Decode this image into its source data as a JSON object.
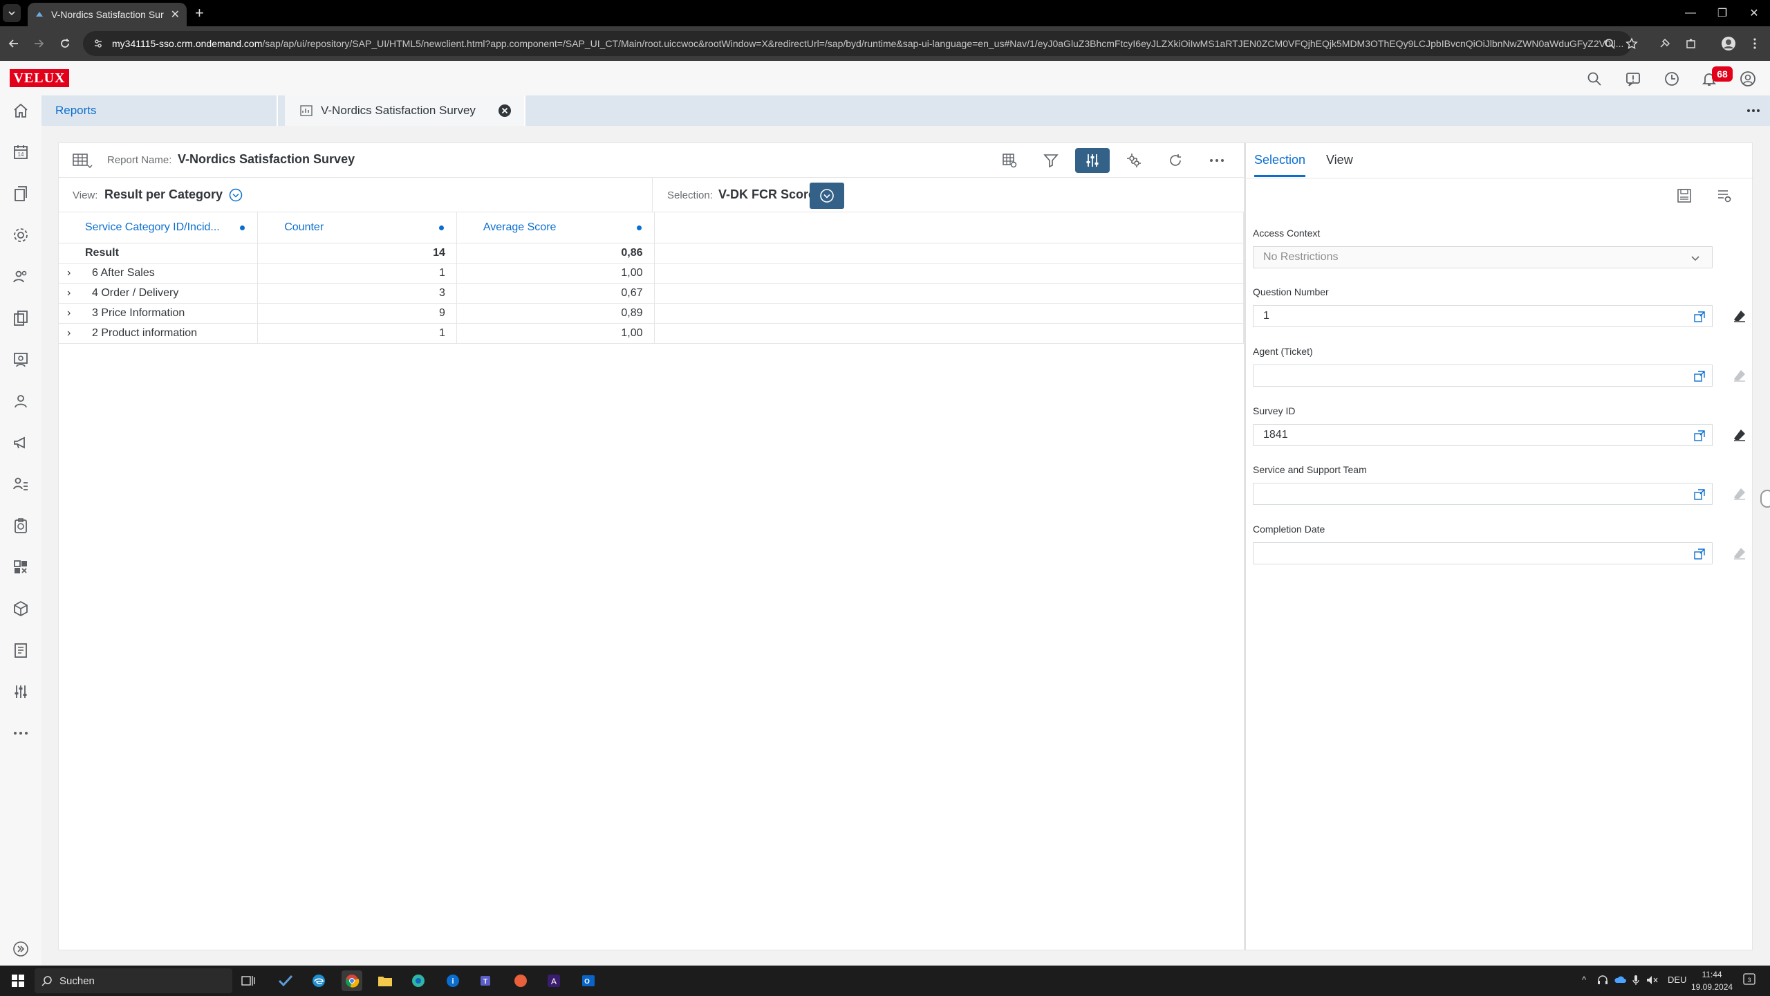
{
  "browser": {
    "tab_title": "V-Nordics Satisfaction Survey -",
    "url_host": "my341115-sso.crm.ondemand.com",
    "url_path": "/sap/ap/ui/repository/SAP_UI/HTML5/newclient.html?app.component=/SAP_UI_CT/Main/root.uiccwoc&rootWindow=X&redirectUrl=/sap/byd/runtime&sap-ui-language=en_us#Nav/1/eyJ0aGluZ3BhcmFtcyI6eyJLZXkiOiIwMS1aRTJEN0ZCM0VFQjhEQjk5MDM3OThEQy9LCJpbIBvcnQiOiJlbnNwZWN0aWduGFyZ2V0Il..."
  },
  "shell": {
    "logo": "VELUX",
    "notification_count": "68"
  },
  "tabs": {
    "reports": "Reports",
    "survey": "V-Nordics Satisfaction Survey"
  },
  "report": {
    "name_label": "Report Name:",
    "name": "V-Nordics Satisfaction Survey",
    "view_label": "View:",
    "view": "Result per Category",
    "selection_label": "Selection:",
    "selection": "V-DK FCR Score",
    "columns": [
      "Service Category ID/Incid...",
      "Counter",
      "Average Score"
    ],
    "result_row": {
      "label": "Result",
      "counter": "14",
      "avg": "0,86"
    },
    "rows": [
      {
        "label": "6 After Sales",
        "counter": "1",
        "avg": "1,00"
      },
      {
        "label": "4 Order / Delivery",
        "counter": "3",
        "avg": "0,67"
      },
      {
        "label": "3 Price Information",
        "counter": "9",
        "avg": "0,89"
      },
      {
        "label": "2 Product information",
        "counter": "1",
        "avg": "1,00"
      }
    ]
  },
  "selection_panel": {
    "tab_selection": "Selection",
    "tab_view": "View",
    "fields": {
      "access_context": {
        "label": "Access Context",
        "value": "No Restrictions"
      },
      "question_number": {
        "label": "Question Number",
        "value": "1"
      },
      "agent_ticket": {
        "label": "Agent (Ticket)",
        "value": ""
      },
      "survey_id": {
        "label": "Survey ID",
        "value": "1841"
      },
      "service_team": {
        "label": "Service and Support Team",
        "value": ""
      },
      "completion_date": {
        "label": "Completion Date",
        "value": ""
      }
    }
  },
  "taskbar": {
    "search_placeholder": "Suchen",
    "language": "DEU",
    "time": "11:44",
    "date": "19.09.2024"
  },
  "colors": {
    "accent": "#0a6ed1",
    "active_button": "#346187",
    "brand_red": "#e2001a"
  }
}
